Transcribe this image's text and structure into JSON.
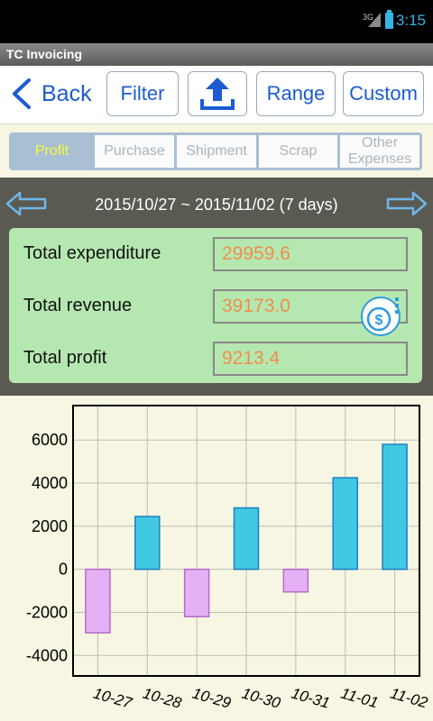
{
  "status_bar": {
    "network": "3G",
    "time": "3:15"
  },
  "app": {
    "title": "TC Invoicing"
  },
  "toolbar": {
    "back_label": "Back",
    "filter_label": "Filter",
    "upload_icon": "upload-icon",
    "range_label": "Range",
    "custom_label": "Custom"
  },
  "tabs": [
    {
      "label": "Profit",
      "active": true
    },
    {
      "label": "Purchase",
      "active": false
    },
    {
      "label": "Shipment",
      "active": false
    },
    {
      "label": "Scrap",
      "active": false
    },
    {
      "label": "Other Expenses",
      "active": false
    }
  ],
  "summary": {
    "date_range": "2015/10/27 ~ 2015/11/02  (7 days)",
    "rows": [
      {
        "label": "Total expenditure",
        "value": "29959.6"
      },
      {
        "label": "Total revenue",
        "value": "39173.0"
      },
      {
        "label": "Total profit",
        "value": "9213.4"
      }
    ]
  },
  "colors": {
    "accent": "#1d5bd2",
    "positive_bar": "#41c8e2",
    "negative_bar": "#e6b0f5",
    "panel": "#b5e7b0",
    "value_text": "#f08f4c"
  },
  "chart_data": {
    "type": "bar",
    "categories": [
      "10-27",
      "10-28",
      "10-29",
      "10-30",
      "10-31",
      "11-01",
      "11-02"
    ],
    "values": [
      -2950,
      2450,
      -2200,
      2850,
      -1050,
      4250,
      5800
    ],
    "yticks": [
      6000,
      4000,
      2000,
      0,
      -2000,
      -4000
    ],
    "ylim": [
      -4950,
      7600
    ],
    "grid": true,
    "title": "",
    "xlabel": "",
    "ylabel": ""
  }
}
